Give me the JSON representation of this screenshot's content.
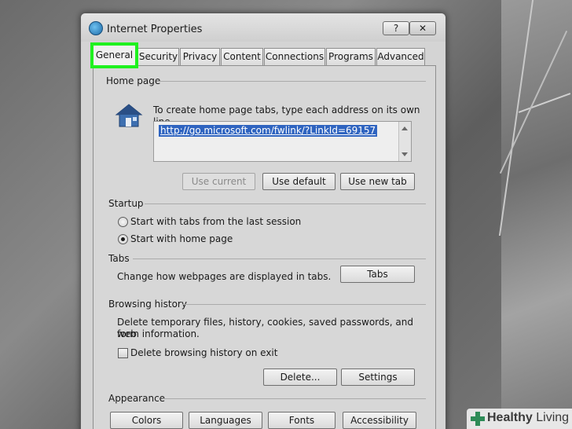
{
  "window": {
    "title": "Internet Properties",
    "help_label": "?",
    "close_label": "✕"
  },
  "tabs": [
    {
      "label": "General",
      "active": true
    },
    {
      "label": "Security"
    },
    {
      "label": "Privacy"
    },
    {
      "label": "Content"
    },
    {
      "label": "Connections"
    },
    {
      "label": "Programs"
    },
    {
      "label": "Advanced"
    }
  ],
  "home_page": {
    "group_label": "Home page",
    "instructions": "To create home page tabs, type each address on its own line.",
    "url": "http://go.microsoft.com/fwlink/?LinkId=69157",
    "use_current": "Use current",
    "use_default": "Use default",
    "use_new_tab": "Use new tab"
  },
  "startup": {
    "group_label": "Startup",
    "option_last_session": "Start with tabs from the last session",
    "option_home_page": "Start with home page",
    "selected": "home_page"
  },
  "tabs_section": {
    "group_label": "Tabs",
    "description": "Change how webpages are displayed in tabs.",
    "button": "Tabs"
  },
  "browsing_history": {
    "group_label": "Browsing history",
    "description_line1": "Delete temporary files, history, cookies, saved passwords, and web",
    "description_line2": "form information.",
    "delete_on_exit_label": "Delete browsing history on exit",
    "delete_on_exit_checked": false,
    "delete_button": "Delete...",
    "settings_button": "Settings"
  },
  "appearance": {
    "group_label": "Appearance",
    "buttons": [
      "Colors",
      "Languages",
      "Fonts",
      "Accessibility"
    ]
  },
  "watermark": {
    "brand_bold": "Healthy",
    "brand_thin": " Living"
  },
  "colors": {
    "highlight": "#1ff11f",
    "selection": "#2f64c0"
  }
}
